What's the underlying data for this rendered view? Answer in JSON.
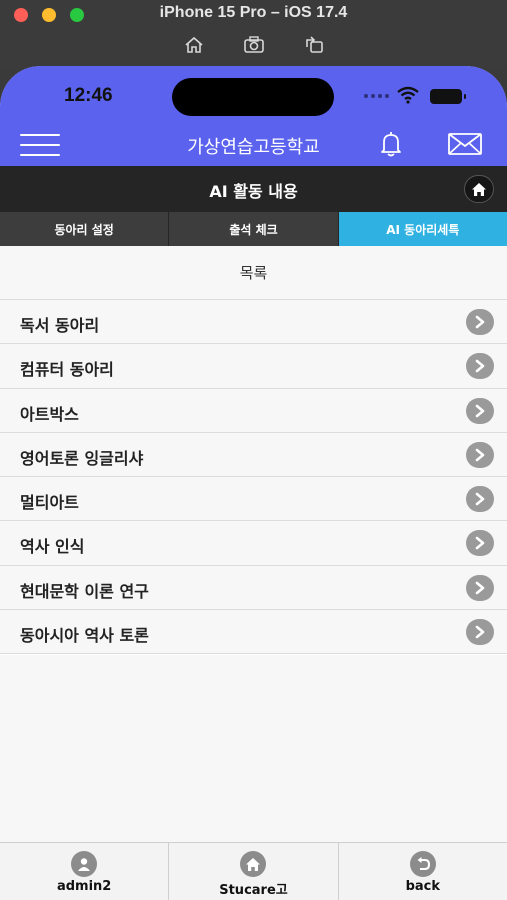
{
  "window": {
    "title": "iPhone 15 Pro – iOS 17.4",
    "toolbar_icons": [
      "home-icon",
      "camera-icon",
      "rotate-icon"
    ]
  },
  "statusbar": {
    "time": "12:46"
  },
  "header": {
    "title": "가상연습고등학교",
    "icons": [
      "menu-icon",
      "bell-icon",
      "mail-icon"
    ],
    "color": "#5b63ee"
  },
  "section": {
    "title": "AI 활동 내용"
  },
  "tabs": [
    {
      "label": "동아리 설정",
      "active": false
    },
    {
      "label": "출석 체크",
      "active": false
    },
    {
      "label": "AI 동아리세특",
      "active": true
    }
  ],
  "list": {
    "header": "목록",
    "items": [
      "독서 동아리",
      "컴퓨터 동아리",
      "아트박스",
      "영어토론 잉글리샤",
      "멀티아트",
      "역사 인식",
      "현대문학 이론 연구",
      "동아시아 역사 토론"
    ]
  },
  "bottom_nav": [
    {
      "label": "admin2",
      "icon": "user-icon"
    },
    {
      "label": "Stucare고",
      "icon": "home-icon"
    },
    {
      "label": "back",
      "icon": "back-icon"
    }
  ],
  "colors": {
    "accent": "#5b63ee",
    "active_tab": "#2fb2e2",
    "dark_bar": "#252525"
  }
}
